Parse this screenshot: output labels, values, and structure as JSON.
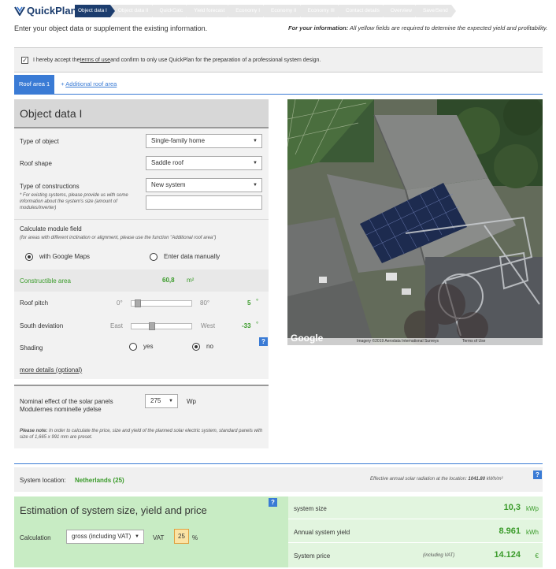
{
  "header": {
    "logo_text": "QuickPlan",
    "steps": [
      "Object data I",
      "Object data II",
      "QuickCalc",
      "Yield forecast",
      "Economy I",
      "Economy II",
      "Economy III",
      "Contact details",
      "Overview",
      "Save/Send"
    ],
    "active_step": 0
  },
  "intro_text": "Enter your object data or supplement the existing information.",
  "info": {
    "lead": "For your information:",
    "text": " All yellow fields are required to detemine the expected yield and profitability."
  },
  "accept": {
    "checked": true,
    "pre": "I hereby accept the ",
    "link": "terms of use",
    "post": " and confirm to only use QuickPlan for the preparation of a professional system design."
  },
  "roof_tabs": {
    "active": "Roof area 1",
    "add_label": "Additional roof area",
    "add_icon": "+"
  },
  "object_data": {
    "title": "Object data I",
    "type_of_object": {
      "label": "Type of object",
      "value": "Single-family home"
    },
    "roof_shape": {
      "label": "Roof shape",
      "value": "Saddle roof"
    },
    "type_of_constructions": {
      "label": "Type of constructions",
      "value": "New system",
      "note": "* For existing systems, please provide us with some information about the system's size (amount of modules/inverter)"
    },
    "module_field": {
      "label": "Calculate module field",
      "note": "(for areas with different inclination or alignment, please use the function \"Additional roof area\")",
      "option_maps": "with Google Maps",
      "option_manual": "Enter data manually",
      "selected": "with Google Maps"
    },
    "constructible_area": {
      "label": "Constructible area",
      "value": "60,8",
      "unit": "m²"
    },
    "roof_pitch": {
      "label": "Roof pitch",
      "min": "0°",
      "max": "80°",
      "value": "5",
      "unit": "°",
      "level": 5
    },
    "south_deviation": {
      "label": "South deviation",
      "min": "East",
      "max": "West",
      "value": "-33",
      "unit": "°",
      "level": -33
    },
    "shading": {
      "label": "Shading",
      "yes": "yes",
      "no": "no",
      "selected": "no"
    },
    "more_details": "more details (optional)"
  },
  "panels": {
    "label_line1": "Nominal effect of the solar panels",
    "label_line2": "Modulernes nominelle ydelse",
    "value": "275",
    "unit": "Wp",
    "note_lead": "Please note:",
    "note_text": " In order to calculate the price, size and yield of the planned solar electric system, standard panels with size of 1,665 x 991 mm are preset."
  },
  "map": {
    "google_label": "Google",
    "attribution": "Imagery ©2019 Aerodata International Surveys",
    "terms": "Terms of Use"
  },
  "location": {
    "label": "System location:",
    "value": "Netherlands (25)",
    "radiation_pre": "Effective annual solar radiation at the location: ",
    "radiation_value": "1041.80",
    "radiation_unit": " kWh/m²"
  },
  "estimation": {
    "title": "Estimation of system size, yield and price",
    "calculation_label": "Calculation",
    "calculation_value": "gross (including VAT)",
    "vat_label": "VAT",
    "vat_value": "25",
    "vat_unit": "%"
  },
  "results": {
    "system_size": {
      "label": "system size",
      "value": "10,3",
      "unit": "kWp"
    },
    "annual_yield": {
      "label": "Annual system yield",
      "value": "8.961",
      "unit": "kWh"
    },
    "system_price": {
      "label": "System price",
      "note": "(including VAT)",
      "value": "14.124",
      "unit": "€"
    }
  },
  "help_icon": "?",
  "caret_icon": "▼",
  "check_glyph": "✓",
  "colors": {
    "accent": "#3a7bd5",
    "brand": "#1c3d6e",
    "green": "#3a9b2a",
    "yellow": "#fbe3a4"
  }
}
